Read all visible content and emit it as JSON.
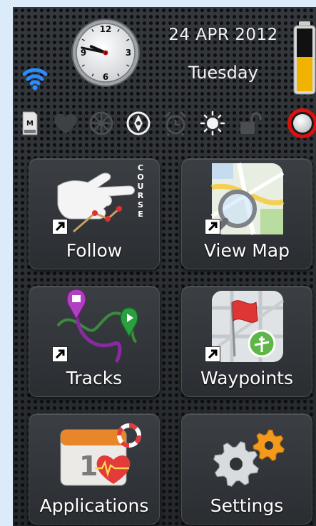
{
  "status": {
    "date": "24 APR 2012",
    "day": "Tuesday",
    "clock": {
      "hours": 9,
      "minutes": 47
    },
    "wifi_icon": "wifi-icon",
    "battery_icon": "battery-icon"
  },
  "icon_bar": {
    "icons": [
      "memory-icon",
      "heart-icon",
      "wheel-icon",
      "compass-icon",
      "alarm-icon",
      "brightness-icon",
      "unlock-icon",
      "record-button-icon"
    ]
  },
  "course_text": "COURSE",
  "tiles": [
    {
      "label": "Follow",
      "icon": "follow-course-icon"
    },
    {
      "label": "View Map",
      "icon": "map-search-icon"
    },
    {
      "label": "Tracks",
      "icon": "tracks-icon"
    },
    {
      "label": "Waypoints",
      "icon": "waypoints-icon"
    },
    {
      "label": "Applications",
      "icon": "calendar-heart-icon"
    },
    {
      "label": "Settings",
      "icon": "gears-icon"
    }
  ],
  "colors": {
    "accent_red": "#e01010",
    "wifi_blue": "#2a8cff",
    "battery_yellow": "#f0b400"
  }
}
